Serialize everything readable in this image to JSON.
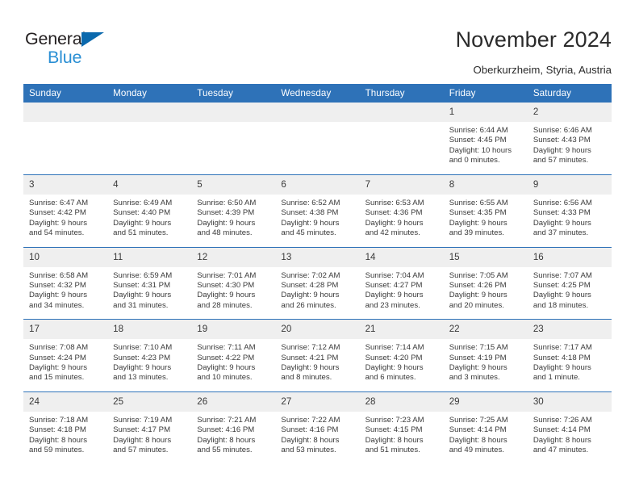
{
  "brand": {
    "name_top": "General",
    "name_bottom": "Blue",
    "triangle_color": "#0b69ad",
    "blue_text_color": "#2a8fd4"
  },
  "header": {
    "title": "November 2024",
    "location": "Oberkurzheim, Styria, Austria"
  },
  "theme": {
    "header_blue": "#2e72b8",
    "daynum_band": "#efefef",
    "text": "#3a3a3a"
  },
  "calendar": {
    "weekday_headers": [
      "Sunday",
      "Monday",
      "Tuesday",
      "Wednesday",
      "Thursday",
      "Friday",
      "Saturday"
    ],
    "weeks": [
      [
        {
          "day": "",
          "info": "",
          "empty": true
        },
        {
          "day": "",
          "info": "",
          "empty": true
        },
        {
          "day": "",
          "info": "",
          "empty": true
        },
        {
          "day": "",
          "info": "",
          "empty": true
        },
        {
          "day": "",
          "info": "",
          "empty": true
        },
        {
          "day": "1",
          "info": "Sunrise: 6:44 AM\nSunset: 4:45 PM\nDaylight: 10 hours\nand 0 minutes.",
          "empty": false
        },
        {
          "day": "2",
          "info": "Sunrise: 6:46 AM\nSunset: 4:43 PM\nDaylight: 9 hours\nand 57 minutes.",
          "empty": false
        }
      ],
      [
        {
          "day": "3",
          "info": "Sunrise: 6:47 AM\nSunset: 4:42 PM\nDaylight: 9 hours\nand 54 minutes.",
          "empty": false
        },
        {
          "day": "4",
          "info": "Sunrise: 6:49 AM\nSunset: 4:40 PM\nDaylight: 9 hours\nand 51 minutes.",
          "empty": false
        },
        {
          "day": "5",
          "info": "Sunrise: 6:50 AM\nSunset: 4:39 PM\nDaylight: 9 hours\nand 48 minutes.",
          "empty": false
        },
        {
          "day": "6",
          "info": "Sunrise: 6:52 AM\nSunset: 4:38 PM\nDaylight: 9 hours\nand 45 minutes.",
          "empty": false
        },
        {
          "day": "7",
          "info": "Sunrise: 6:53 AM\nSunset: 4:36 PM\nDaylight: 9 hours\nand 42 minutes.",
          "empty": false
        },
        {
          "day": "8",
          "info": "Sunrise: 6:55 AM\nSunset: 4:35 PM\nDaylight: 9 hours\nand 39 minutes.",
          "empty": false
        },
        {
          "day": "9",
          "info": "Sunrise: 6:56 AM\nSunset: 4:33 PM\nDaylight: 9 hours\nand 37 minutes.",
          "empty": false
        }
      ],
      [
        {
          "day": "10",
          "info": "Sunrise: 6:58 AM\nSunset: 4:32 PM\nDaylight: 9 hours\nand 34 minutes.",
          "empty": false
        },
        {
          "day": "11",
          "info": "Sunrise: 6:59 AM\nSunset: 4:31 PM\nDaylight: 9 hours\nand 31 minutes.",
          "empty": false
        },
        {
          "day": "12",
          "info": "Sunrise: 7:01 AM\nSunset: 4:30 PM\nDaylight: 9 hours\nand 28 minutes.",
          "empty": false
        },
        {
          "day": "13",
          "info": "Sunrise: 7:02 AM\nSunset: 4:28 PM\nDaylight: 9 hours\nand 26 minutes.",
          "empty": false
        },
        {
          "day": "14",
          "info": "Sunrise: 7:04 AM\nSunset: 4:27 PM\nDaylight: 9 hours\nand 23 minutes.",
          "empty": false
        },
        {
          "day": "15",
          "info": "Sunrise: 7:05 AM\nSunset: 4:26 PM\nDaylight: 9 hours\nand 20 minutes.",
          "empty": false
        },
        {
          "day": "16",
          "info": "Sunrise: 7:07 AM\nSunset: 4:25 PM\nDaylight: 9 hours\nand 18 minutes.",
          "empty": false
        }
      ],
      [
        {
          "day": "17",
          "info": "Sunrise: 7:08 AM\nSunset: 4:24 PM\nDaylight: 9 hours\nand 15 minutes.",
          "empty": false
        },
        {
          "day": "18",
          "info": "Sunrise: 7:10 AM\nSunset: 4:23 PM\nDaylight: 9 hours\nand 13 minutes.",
          "empty": false
        },
        {
          "day": "19",
          "info": "Sunrise: 7:11 AM\nSunset: 4:22 PM\nDaylight: 9 hours\nand 10 minutes.",
          "empty": false
        },
        {
          "day": "20",
          "info": "Sunrise: 7:12 AM\nSunset: 4:21 PM\nDaylight: 9 hours\nand 8 minutes.",
          "empty": false
        },
        {
          "day": "21",
          "info": "Sunrise: 7:14 AM\nSunset: 4:20 PM\nDaylight: 9 hours\nand 6 minutes.",
          "empty": false
        },
        {
          "day": "22",
          "info": "Sunrise: 7:15 AM\nSunset: 4:19 PM\nDaylight: 9 hours\nand 3 minutes.",
          "empty": false
        },
        {
          "day": "23",
          "info": "Sunrise: 7:17 AM\nSunset: 4:18 PM\nDaylight: 9 hours\nand 1 minute.",
          "empty": false
        }
      ],
      [
        {
          "day": "24",
          "info": "Sunrise: 7:18 AM\nSunset: 4:18 PM\nDaylight: 8 hours\nand 59 minutes.",
          "empty": false
        },
        {
          "day": "25",
          "info": "Sunrise: 7:19 AM\nSunset: 4:17 PM\nDaylight: 8 hours\nand 57 minutes.",
          "empty": false
        },
        {
          "day": "26",
          "info": "Sunrise: 7:21 AM\nSunset: 4:16 PM\nDaylight: 8 hours\nand 55 minutes.",
          "empty": false
        },
        {
          "day": "27",
          "info": "Sunrise: 7:22 AM\nSunset: 4:16 PM\nDaylight: 8 hours\nand 53 minutes.",
          "empty": false
        },
        {
          "day": "28",
          "info": "Sunrise: 7:23 AM\nSunset: 4:15 PM\nDaylight: 8 hours\nand 51 minutes.",
          "empty": false
        },
        {
          "day": "29",
          "info": "Sunrise: 7:25 AM\nSunset: 4:14 PM\nDaylight: 8 hours\nand 49 minutes.",
          "empty": false
        },
        {
          "day": "30",
          "info": "Sunrise: 7:26 AM\nSunset: 4:14 PM\nDaylight: 8 hours\nand 47 minutes.",
          "empty": false
        }
      ]
    ]
  }
}
